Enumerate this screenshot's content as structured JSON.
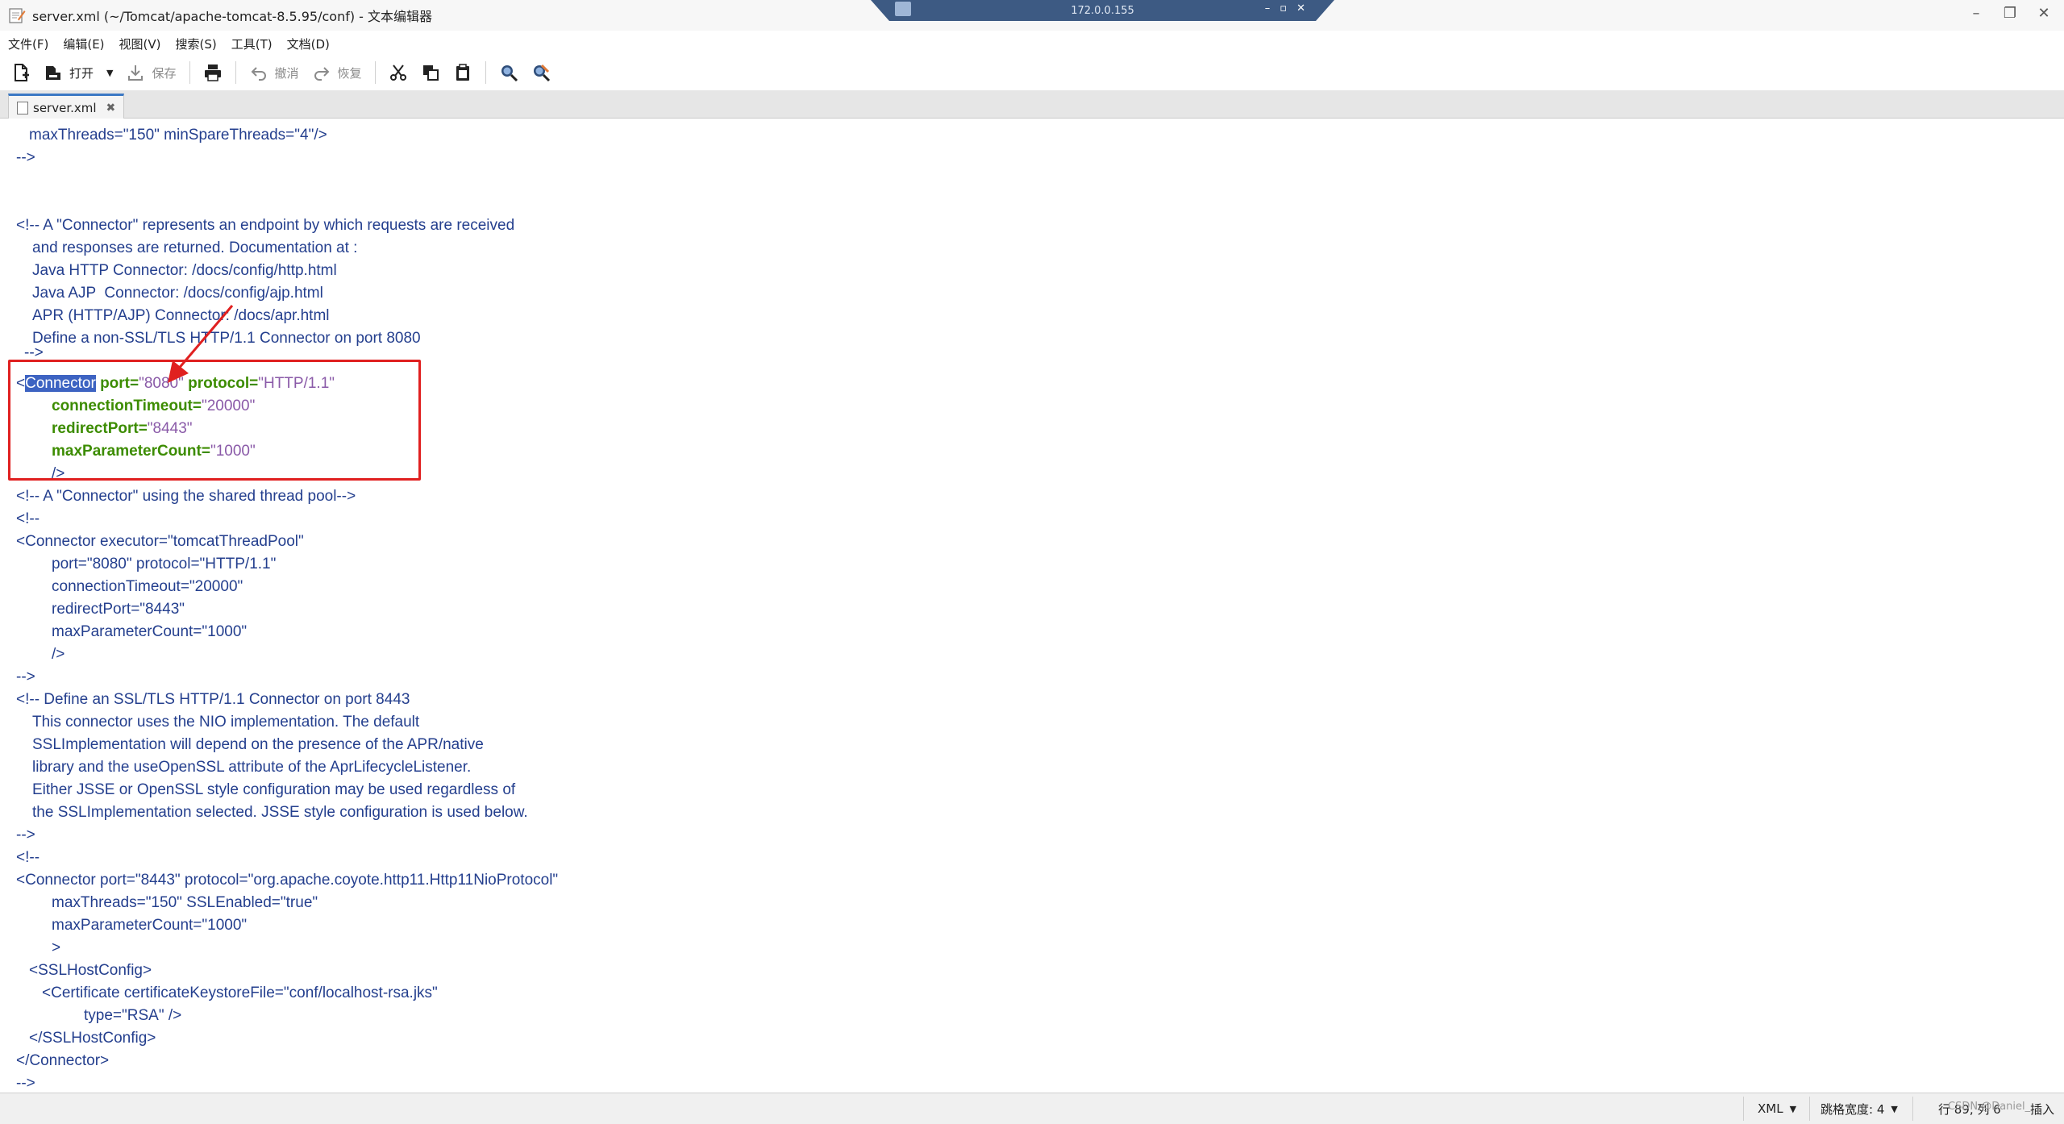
{
  "window": {
    "title": "server.xml (~/Tomcat/apache-tomcat-8.5.95/conf) - 文本编辑器",
    "remote_host": "172.0.0.155"
  },
  "menu": [
    "文件(F)",
    "编辑(E)",
    "视图(V)",
    "搜索(S)",
    "工具(T)",
    "文档(D)"
  ],
  "toolbar": {
    "open_label": "打开",
    "save_label": "保存",
    "undo_label": "撤消",
    "redo_label": "恢复"
  },
  "tabs": [
    {
      "label": "server.xml"
    }
  ],
  "editor": {
    "lines": {
      "l1": "maxThreads=\"150\" minSpareThreads=\"4\"/>",
      "l2": "-->",
      "l5": "<!-- A \"Connector\" represents an endpoint by which requests are received",
      "l6": "and responses are returned. Documentation at :",
      "l7": "Java HTTP Connector: /docs/config/http.html",
      "l8": "Java AJP  Connector: /docs/config/ajp.html",
      "l9": "APR (HTTP/AJP) Connector: /docs/apr.html",
      "l10": "Define a non-SSL/TLS HTTP/1.1 Connector on port 8080",
      "l11": "-->",
      "l12_lt": "<",
      "l12_sel": "Connector",
      "l12_attr1": "port=",
      "l12_val1": "\"8080\"",
      "l12_attr2": "protocol=",
      "l12_val2": "\"HTTP/1.1\"",
      "l13_attr": "connectionTimeout=",
      "l13_val": "\"20000\"",
      "l14_attr": "redirectPort=",
      "l14_val": "\"8443\"",
      "l15_attr": "maxParameterCount=",
      "l15_val": "\"1000\"",
      "l16": "/>",
      "l17": "<!-- A \"Connector\" using the shared thread pool-->",
      "l18": "<!--",
      "l19": "<Connector executor=\"tomcatThreadPool\"",
      "l20": "port=\"8080\" protocol=\"HTTP/1.1\"",
      "l21": "connectionTimeout=\"20000\"",
      "l22": "redirectPort=\"8443\"",
      "l23": "maxParameterCount=\"1000\"",
      "l24": "/>",
      "l25": "-->",
      "l26": "<!-- Define an SSL/TLS HTTP/1.1 Connector on port 8443",
      "l27": "This connector uses the NIO implementation. The default",
      "l28": "SSLImplementation will depend on the presence of the APR/native",
      "l29": "library and the useOpenSSL attribute of the AprLifecycleListener.",
      "l30": "Either JSSE or OpenSSL style configuration may be used regardless of",
      "l31": "the SSLImplementation selected. JSSE style configuration is used below.",
      "l32": "-->",
      "l33": "<!--",
      "l34": "<Connector port=\"8443\" protocol=\"org.apache.coyote.http11.Http11NioProtocol\"",
      "l35": "maxThreads=\"150\" SSLEnabled=\"true\"",
      "l36": "maxParameterCount=\"1000\"",
      "l37": ">",
      "l38": "<SSLHostConfig>",
      "l39": "<Certificate certificateKeystoreFile=\"conf/localhost-rsa.jks\"",
      "l40": "type=\"RSA\" />",
      "l41": "</SSLHostConfig>",
      "l42": "</Connector>",
      "l43": "-->"
    }
  },
  "statusbar": {
    "language": "XML",
    "tab_width": "跳格宽度: 4",
    "position": "行 89, 列 6",
    "mode": "插入",
    "watermark": "CSDN @Daniel_"
  },
  "colors": {
    "text": "#243f8e",
    "attribute": "#3c8c00",
    "value": "#8a5aa8",
    "selection": "#3d63c2",
    "highlight_box": "#e02020"
  }
}
